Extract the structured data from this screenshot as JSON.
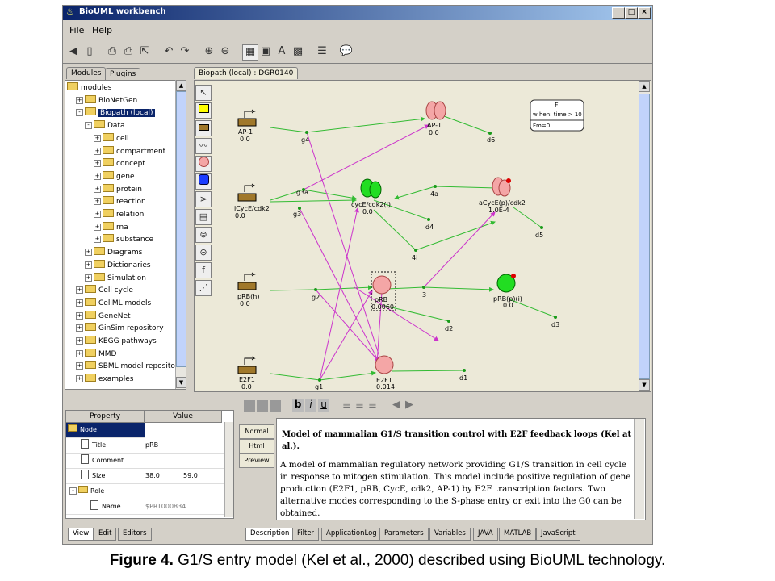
{
  "window": {
    "title": "BioUML workbench",
    "controls": [
      "_",
      "□",
      "×"
    ]
  },
  "menu": [
    "File",
    "Help"
  ],
  "toolbar_icons": [
    "back-icon",
    "new-icon",
    "print-icon",
    "print-preview-icon",
    "export-icon",
    "undo-icon",
    "redo-icon",
    "zoom-in-icon",
    "zoom-out-icon",
    "layout-icon",
    "refresh-icon",
    "text-icon",
    "grid-icon",
    "options-icon",
    "help-icon"
  ],
  "left_tabs": [
    "Modules",
    "Plugins"
  ],
  "tree": [
    {
      "label": "modules",
      "level": 0,
      "exp": ""
    },
    {
      "label": "BioNetGen",
      "level": 1,
      "exp": "+"
    },
    {
      "label": "Biopath (local)",
      "level": 1,
      "exp": "-",
      "selected": true
    },
    {
      "label": "Data",
      "level": 2,
      "exp": "-"
    },
    {
      "label": "cell",
      "level": 3,
      "exp": "+"
    },
    {
      "label": "compartment",
      "level": 3,
      "exp": "+"
    },
    {
      "label": "concept",
      "level": 3,
      "exp": "+"
    },
    {
      "label": "gene",
      "level": 3,
      "exp": "+"
    },
    {
      "label": "protein",
      "level": 3,
      "exp": "+"
    },
    {
      "label": "reaction",
      "level": 3,
      "exp": "+"
    },
    {
      "label": "relation",
      "level": 3,
      "exp": "+"
    },
    {
      "label": "rna",
      "level": 3,
      "exp": "+"
    },
    {
      "label": "substance",
      "level": 3,
      "exp": "+"
    },
    {
      "label": "Diagrams",
      "level": 2,
      "exp": "+"
    },
    {
      "label": "Dictionaries",
      "level": 2,
      "exp": "+"
    },
    {
      "label": "Simulation",
      "level": 2,
      "exp": "+"
    },
    {
      "label": "Cell cycle",
      "level": 1,
      "exp": "+"
    },
    {
      "label": "CellML models",
      "level": 1,
      "exp": "+"
    },
    {
      "label": "GeneNet",
      "level": 1,
      "exp": "+"
    },
    {
      "label": "GinSim repository",
      "level": 1,
      "exp": "+"
    },
    {
      "label": "KEGG pathways",
      "level": 1,
      "exp": "+"
    },
    {
      "label": "MMD",
      "level": 1,
      "exp": "+"
    },
    {
      "label": "SBML model repository",
      "level": 1,
      "exp": "+"
    },
    {
      "label": "examples",
      "level": 1,
      "exp": "+"
    }
  ],
  "diagram_tab": "Biopath (local) : DGR0140",
  "palette_icons": [
    "select-arrow-icon",
    "compartment-icon",
    "gene-icon",
    "wave-icon",
    "protein-pink-icon",
    "protein-blue-icon",
    "reaction-icon",
    "note-icon",
    "equation-icon",
    "equation2-icon",
    "function-icon",
    "edge-icon"
  ],
  "diagram": {
    "genes": [
      {
        "name": "AP-1",
        "value": "0.0"
      },
      {
        "name": "iCycE/cdk2",
        "value": "0.0"
      },
      {
        "name": "pRB(h)",
        "value": "0.0"
      },
      {
        "name": "E2F1",
        "value": "0.0"
      }
    ],
    "proteins": [
      {
        "name": "AP-1",
        "value": "0.0"
      },
      {
        "name": "cycE/cdk2(i)",
        "value": "0.0"
      },
      {
        "name": "aCycE(p)/cdk2",
        "value": "1.0E-4"
      },
      {
        "name": "pRB",
        "value": "0.0060"
      },
      {
        "name": "pRB(p)(i)",
        "value": "0.0"
      },
      {
        "name": "E2F1",
        "value": "0.014"
      }
    ],
    "points": [
      "g4",
      "d6",
      "g3a",
      "g3",
      "4a",
      "d4",
      "d5",
      "4i",
      "g2",
      "3",
      "d2",
      "d3",
      "g1",
      "d1"
    ],
    "event_box": {
      "title": "F",
      "when": "w hen: time > 10",
      "assign": "Fm=0"
    }
  },
  "props": {
    "headers": [
      "Property",
      "Value"
    ],
    "rows": [
      {
        "key": "Node",
        "value": "",
        "value2": ""
      },
      {
        "key": "Title",
        "value": "pRB",
        "value2": ""
      },
      {
        "key": "Comment",
        "value": "",
        "value2": ""
      },
      {
        "key": "Size",
        "value": "38.0",
        "value2": "59.0"
      },
      {
        "key": "Role",
        "value": "",
        "value2": ""
      },
      {
        "key": "Name",
        "value": "$PRT000834",
        "value2": ""
      }
    ]
  },
  "props_tabs": [
    "View",
    "Edit",
    "Editors"
  ],
  "format_buttons": [
    "b",
    "i",
    "u"
  ],
  "view_buttons": [
    "Normal",
    "Html",
    "Preview"
  ],
  "description": {
    "title": "Model of mammalian G1/S transition control with E2F feedback loops (Kel at al.).",
    "body": "A model of mammalian regulatory network providing G1/S transition in cell cycle in response to mitogen stimulation. This model include positive regulation of gene production (E2F1, pRB, CycE, cdk2, AP-1) by E2F transcription factors. Two alternative modes corresponding to the S-phase entry or exit into the G0 can be obtained."
  },
  "bottom_tabs": [
    "Description",
    "Filter",
    "ApplicationLog",
    "Parameters",
    "Variables",
    "JAVA",
    "MATLAB",
    "JavaScript"
  ],
  "caption": {
    "bold": "Figure 4.",
    "text": " G1/S entry model (Kel et al., 2000) described using BioUML technology."
  },
  "colors": {
    "title_bar": "#0a246a",
    "protein_pink": "#f4a6a6",
    "protein_green": "#22dd22",
    "edge_green": "#33bb33",
    "edge_magenta": "#cc33cc",
    "gene_brown": "#a0782a"
  }
}
